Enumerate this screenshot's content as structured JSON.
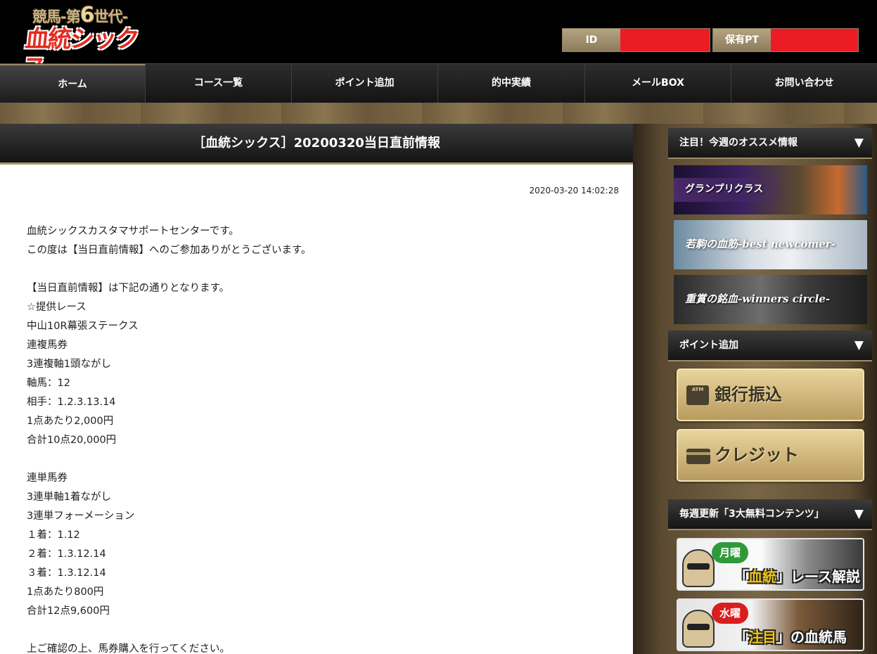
{
  "header": {
    "logo_sub_prefix": "競馬-第",
    "logo_sub_num": "6",
    "logo_sub_suffix": "世代-",
    "logo_main": "血統シックス",
    "id_label": "ID",
    "points_label": "保有PT"
  },
  "nav": {
    "items": [
      {
        "label": "ホーム",
        "active": true
      },
      {
        "label": "コース一覧"
      },
      {
        "label": "ポイント追加"
      },
      {
        "label": "的中実績"
      },
      {
        "label": "メールBOX"
      },
      {
        "label": "お問い合わせ"
      }
    ]
  },
  "article": {
    "title": "［血統シックス］20200320当日直前情報",
    "date": "2020-03-20 14:02:28",
    "lines": [
      "血統シックスカスタマサポートセンターです。",
      "この度は【当日直前情報】へのご参加ありがとうございます。",
      "",
      "【当日直前情報】は下記の通りとなります。",
      "☆提供レース",
      "中山10R幕張ステークス",
      "連複馬券",
      "3連複軸1頭ながし",
      "軸馬：12",
      "相手：1.2.3.13.14",
      "1点あたり2,000円",
      "合計10点20,000円",
      "",
      "連単馬券",
      "3連単軸1着ながし",
      "3連単フォーメーション",
      "１着：1.12",
      "２着：1.3.12.14",
      "３着：1.3.12.14",
      "1点あたり800円",
      "合計12点9,600円",
      "",
      "上ご確認の上、馬券購入を行ってください。"
    ]
  },
  "sidebar": {
    "recommend_title": "注目！今週のオススメ情報",
    "arrow": "▼",
    "banners": {
      "grand": "グランプリクラス",
      "young": "若駒の血筋-best newcomer-",
      "winners": "重賞の銘血-winners circle-"
    },
    "points_title": "ポイント追加",
    "bank_label": "銀行振込",
    "atm_text": "ATM",
    "credit_label": "クレジット",
    "free_title": "毎週更新「3大無料コンテンツ」",
    "free": {
      "mon_day": "月曜",
      "mon_q1": "「",
      "mon_hl": "血統",
      "mon_q2": "」レース解説",
      "wed_day": "水曜",
      "wed_q1": "「",
      "wed_hl": "注目",
      "wed_q2": "」の血統馬"
    }
  }
}
